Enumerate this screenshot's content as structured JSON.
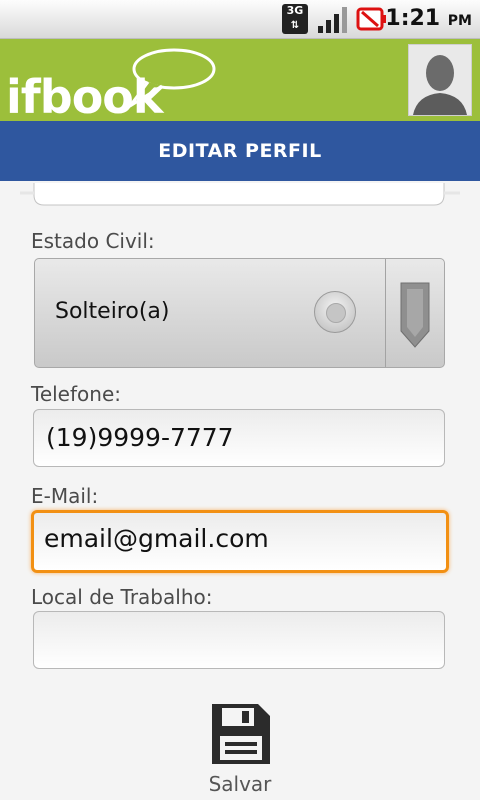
{
  "status_bar": {
    "network": "3G",
    "time": "1:21",
    "ampm": "PM"
  },
  "app": {
    "logo": "ifbook"
  },
  "page": {
    "title": "EDITAR PERFIL"
  },
  "form": {
    "estado_civil": {
      "label": "Estado Civil:",
      "value": "Solteiro(a)"
    },
    "telefone": {
      "label": "Telefone:",
      "value": "(19)9999-7777"
    },
    "email": {
      "label": "E-Mail:",
      "value": "email@gmail.com"
    },
    "local_trabalho": {
      "label": "Local de Trabalho:",
      "value": ""
    }
  },
  "actions": {
    "save_label": "Salvar"
  },
  "colors": {
    "appbar": "#9cbf3b",
    "titlebar": "#2f579f",
    "focus": "#f29013"
  }
}
